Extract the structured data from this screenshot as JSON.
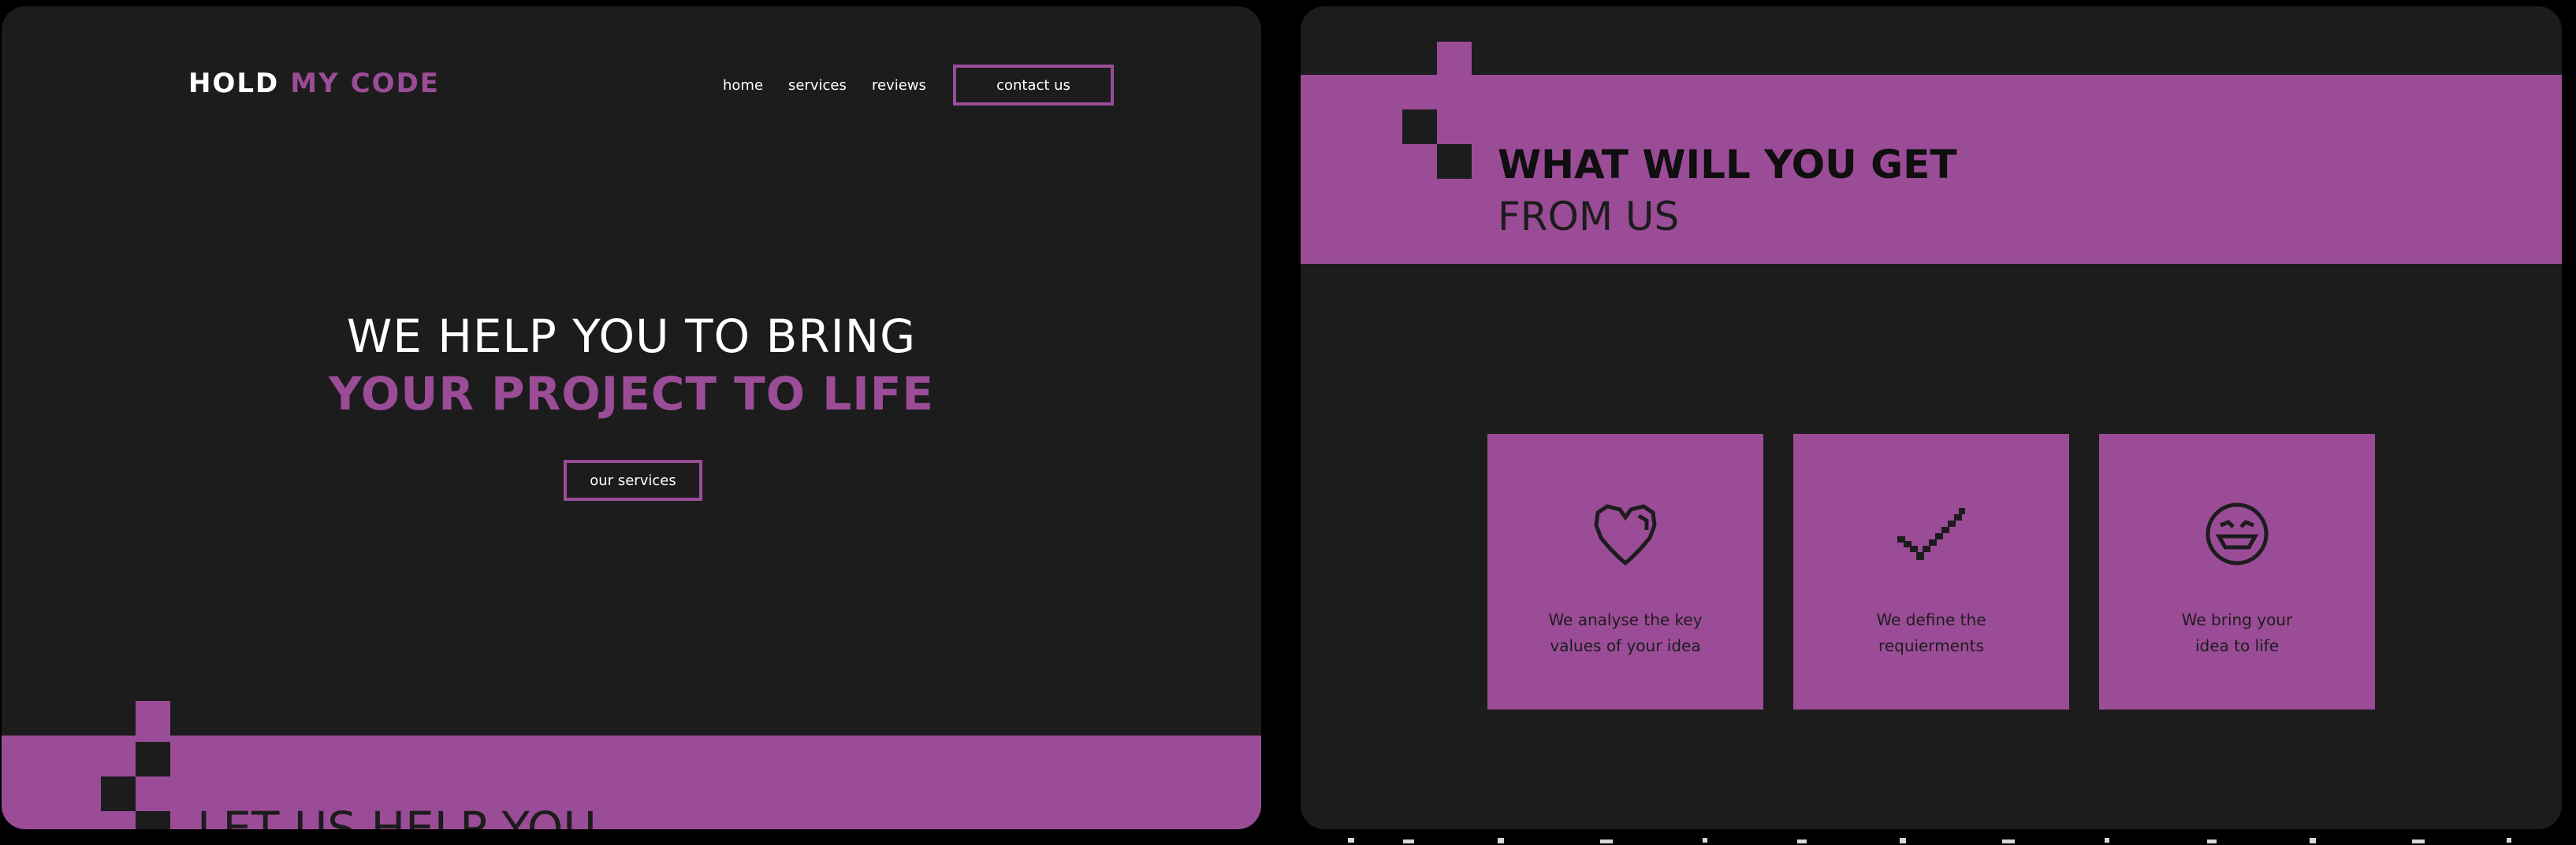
{
  "landing": {
    "logo": {
      "part1": "HOLD",
      "part2": "MY",
      "part3": "CODE"
    },
    "nav": {
      "home": "home",
      "services": "services",
      "reviews": "reviews"
    },
    "contact_button": "contact us",
    "hero": {
      "line1": "WE HELP YOU TO BRING",
      "line2": "YOUR PROJECT TO LIFE",
      "button": "our services"
    },
    "next_section_title": "LET US HELP YOU"
  },
  "features": {
    "title_line1": "WHAT WILL YOU GET",
    "title_line2": "FROM US",
    "cards": [
      {
        "icon": "heart-icon",
        "text_line1": "We analyse the key",
        "text_line2": "values of your idea"
      },
      {
        "icon": "checkmark-icon",
        "text_line1": "We define the",
        "text_line2": "requierments"
      },
      {
        "icon": "smiley-icon",
        "text_line1": "We bring your",
        "text_line2": "idea to life"
      }
    ]
  },
  "colors": {
    "background": "#1c1c1c",
    "accent": "#9b4c97",
    "text_light": "#ffffff",
    "text_dark": "#1c1c1c"
  }
}
